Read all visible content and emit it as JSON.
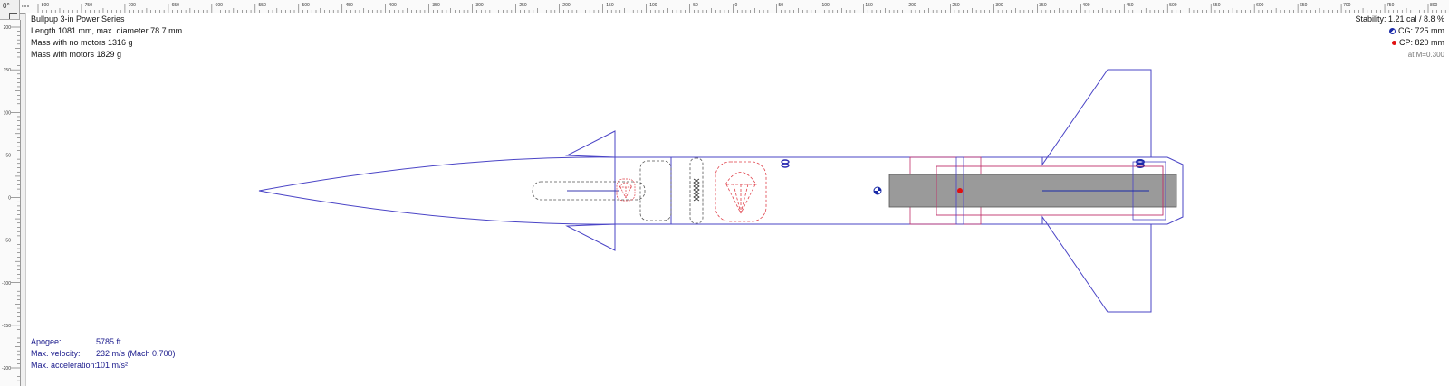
{
  "ruler": {
    "corner_label": "0°",
    "unit": "mm",
    "h_ticks": [
      "-800",
      "-750",
      "-700",
      "-650",
      "-600",
      "-550",
      "-500",
      "-450",
      "-400",
      "-350",
      "-300",
      "-250",
      "-200",
      "-150",
      "-100",
      "-50",
      "0",
      "50",
      "100",
      "150",
      "200",
      "250",
      "300",
      "350",
      "400",
      "450",
      "500",
      "550",
      "600",
      "650",
      "700",
      "750",
      "800"
    ],
    "v_ticks": [
      "200",
      "150",
      "100",
      "50",
      "0",
      "-50",
      "-100",
      "-150",
      "-200"
    ]
  },
  "design": {
    "name": "Bullpup 3-in Power Series",
    "length_line": "Length 1081 mm, max. diameter 78.7 mm",
    "mass_no_motors": "Mass with no motors 1316 g",
    "mass_with_motors": "Mass with motors 1829 g"
  },
  "stability": {
    "stability_line": "Stability: 1.21 cal / 8.8 %",
    "cg": "CG: 725 mm",
    "cp": "CP: 820 mm",
    "mach": "at M=0.300"
  },
  "flight": {
    "apogee_label": "Apogee:",
    "apogee_value": "5785 ft",
    "velocity_label": "Max. velocity:",
    "velocity_value": "232 m/s  (Mach 0.700)",
    "accel_label": "Max. acceleration:",
    "accel_value": "101 m/s²"
  },
  "colors": {
    "body_outline": "#4a44c6",
    "recovery": "#e0404a",
    "inner_tube": "#c0306a",
    "motor": "#9a9a9a",
    "cp_marker": "#e01010",
    "cg_marker": "#1a2aa8",
    "stats_text": "#1a1a8c"
  }
}
